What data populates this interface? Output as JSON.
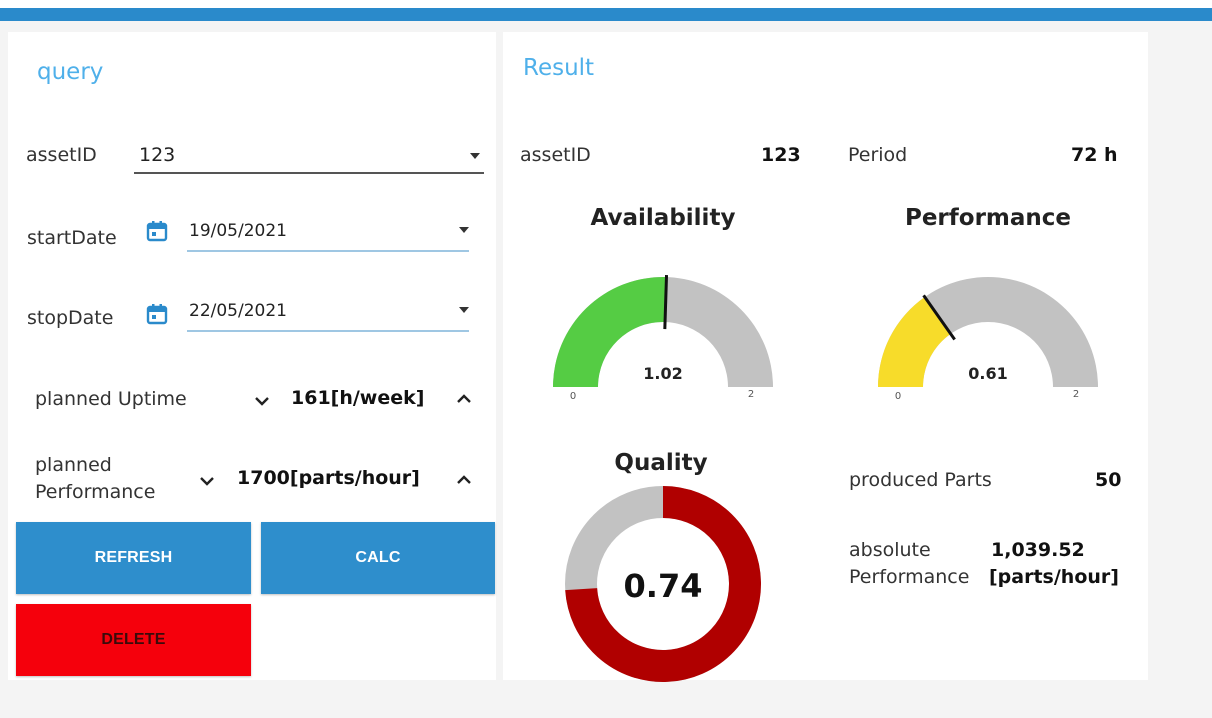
{
  "colors": {
    "header_bar": "#2a8acb",
    "accent_title": "#4fb0ea",
    "button_blue": "#2e8ecc",
    "button_red": "#f5000c",
    "availability_fill": "#55cc44",
    "performance_fill": "#f7dc2a",
    "quality_fill": "#b00000",
    "gauge_track": "#c2c2c2"
  },
  "query": {
    "title": "query",
    "asset_id": {
      "label": "assetID",
      "value": "123"
    },
    "start_date": {
      "label": "startDate",
      "value": "19/05/2021",
      "icon": "calendar-icon"
    },
    "stop_date": {
      "label": "stopDate",
      "value": "22/05/2021",
      "icon": "calendar-icon"
    },
    "planned_uptime": {
      "label": "planned Uptime",
      "value": "161[h/week]"
    },
    "planned_performance": {
      "label_line1": "planned",
      "label_line2": "Performance",
      "value": "1700[parts/hour]"
    },
    "buttons": {
      "refresh": "REFRESH",
      "calc": "CALC",
      "delete": "DELETE"
    }
  },
  "result": {
    "title": "Result",
    "asset_id": {
      "label": "assetID",
      "value": "123"
    },
    "period": {
      "label": "Period",
      "value": "72 h"
    },
    "produced_parts": {
      "label": "produced Parts",
      "value": "50"
    },
    "absolute_performance": {
      "label_line1": "absolute",
      "label_line2": "Performance",
      "value_line1": "1,039.52",
      "value_line2": "[parts/hour]"
    },
    "availability": {
      "title": "Availability",
      "value": 1.02,
      "value_label": "1.02",
      "min": 0,
      "max": 2,
      "min_label": "0",
      "max_label": "2"
    },
    "performance": {
      "title": "Performance",
      "value": 0.61,
      "value_label": "0.61",
      "min": 0,
      "max": 2,
      "min_label": "0",
      "max_label": "2"
    },
    "quality": {
      "title": "Quality",
      "value": 0.74,
      "value_label": "0.74",
      "min": 0,
      "max": 1
    }
  }
}
